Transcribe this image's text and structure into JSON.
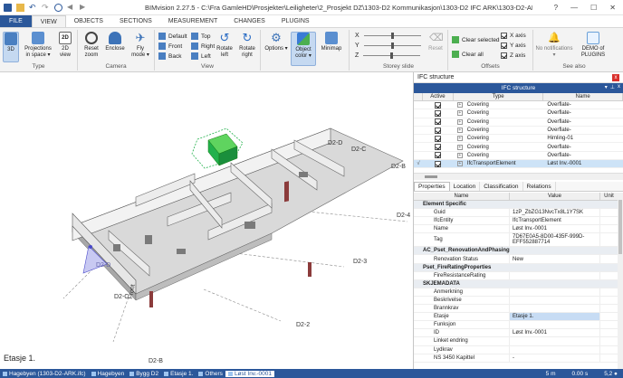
{
  "window": {
    "title": "BIMvision 2.27.5 - C:\\Fra GamleHD\\Prosjekter\\Leiligheter\\2_Prosjekt DZ\\1303-D2 Kommunikasjon\\1303-D2 IFC ARK\\1303-D2-ARK.ifc",
    "help": "?",
    "minimize": "—",
    "maximize": "☐",
    "close": "✕"
  },
  "tabs": [
    "FILE",
    "VIEW",
    "OBJECTS",
    "SECTIONS",
    "MEASUREMENT",
    "CHANGES",
    "PLUGINS"
  ],
  "active_tab": "VIEW",
  "ribbon": {
    "type_group": {
      "label": "Type",
      "btn_3d": "3D",
      "btn_projections": "Projections in space ▾",
      "btn_2d": "2D view"
    },
    "camera_group": {
      "label": "Camera",
      "reset_zoom": "Reset zoom",
      "enclose": "Enclose",
      "fly_mode": "Fly mode ▾"
    },
    "view_group": {
      "label": "View",
      "default": "Default",
      "top": "Top",
      "front": "Front",
      "right": "Right",
      "back": "Back",
      "left": "Left",
      "rotate_left": "Rotate left",
      "rotate_right": "Rotate right"
    },
    "options_group": {
      "options": "Options ▾",
      "object_color": "Object color ▾",
      "minimap": "Minimap"
    },
    "storey_group": {
      "label": "Storey slide",
      "x": "X",
      "y": "Y",
      "z": "Z",
      "reset": "Reset"
    },
    "offsets_group": {
      "label": "Offsets",
      "clear_selected": "Clear selected",
      "clear_all": "Clear all",
      "x_axis": "X axis",
      "y_axis": "Y axis",
      "z_axis": "Z axis"
    },
    "seealso_group": {
      "label": "See also",
      "no_notifications": "No notifications ▾",
      "demo_plugins": "DEMO of PLUGINS"
    }
  },
  "viewport": {
    "labels": [
      "D2-D",
      "D2-C",
      "D2-B",
      "D2-4",
      "D2-3",
      "D2-2",
      "D2-B",
      "D2-C",
      "D2-D",
      "Front"
    ],
    "storey": "Etasje 1."
  },
  "panel": {
    "title": "IFC structure",
    "close": "x",
    "tree_title": "IFC structure",
    "columns": [
      "Active",
      "Type",
      "Name"
    ],
    "rows": [
      {
        "type": "Covering",
        "name": "Overflate-",
        "selected": false
      },
      {
        "type": "Covering",
        "name": "Overflate-",
        "selected": false
      },
      {
        "type": "Covering",
        "name": "Overflate-",
        "selected": false
      },
      {
        "type": "Covering",
        "name": "Overflate-",
        "selected": false
      },
      {
        "type": "Covering",
        "name": "Himling-01",
        "selected": false
      },
      {
        "type": "Covering",
        "name": "Overflate-",
        "selected": false
      },
      {
        "type": "Covering",
        "name": "Overflate-",
        "selected": false
      },
      {
        "type": "IfcTransportElement",
        "name": "Løst Inv.-0001",
        "selected": true
      }
    ],
    "prop_tabs": [
      "Properties",
      "Location",
      "Classification",
      "Relations"
    ],
    "prop_columns": [
      "Name",
      "Value",
      "Unit"
    ],
    "props": [
      {
        "kind": "section",
        "name": "Element Specific"
      },
      {
        "kind": "row",
        "name": "Guid",
        "value": "1zP_ZbZG13NvcTx8L1Y7SK"
      },
      {
        "kind": "row",
        "name": "IfcEntity",
        "value": "IfcTransportElement"
      },
      {
        "kind": "row",
        "name": "Name",
        "value": "Løst Inv.-0001"
      },
      {
        "kind": "tall",
        "name": "Tag",
        "value": "7D67E0A5-8D00-435F-999D-EFF552887714"
      },
      {
        "kind": "section",
        "name": "AC_Pset_RenovationAndPhasing"
      },
      {
        "kind": "row",
        "name": "Renovation Status",
        "value": "New"
      },
      {
        "kind": "section",
        "name": "Pset_FireRatingProperties"
      },
      {
        "kind": "row",
        "name": "FireResistanceRating",
        "value": ""
      },
      {
        "kind": "section",
        "name": "SKJEMADATA"
      },
      {
        "kind": "row",
        "name": "Anmerkning",
        "value": ""
      },
      {
        "kind": "row",
        "name": "Beskrivelse",
        "value": ""
      },
      {
        "kind": "row",
        "name": "Brannkrav",
        "value": ""
      },
      {
        "kind": "hl",
        "name": "Etasje",
        "value": "Etasje 1."
      },
      {
        "kind": "row",
        "name": "Funksjon",
        "value": ""
      },
      {
        "kind": "row",
        "name": "ID",
        "value": "Løst Inv.-0001"
      },
      {
        "kind": "row",
        "name": "Linket endring",
        "value": ""
      },
      {
        "kind": "row",
        "name": "Lydkrav",
        "value": ""
      },
      {
        "kind": "row",
        "name": "NS 3450 Kapittel",
        "value": "-"
      }
    ]
  },
  "statusbar": {
    "crumbs": [
      "Hagebyen (1303-D2-ARK.ifc)",
      "Hagebyen",
      "Bygg D2",
      "Etasje 1.",
      "Others",
      "Løst Inv.-0001"
    ],
    "distance": "5 m",
    "time": "0.00 s",
    "fps": "5,2 ●"
  },
  "colors": {
    "accent": "#2b579a",
    "selected_object": "#22b14c"
  }
}
